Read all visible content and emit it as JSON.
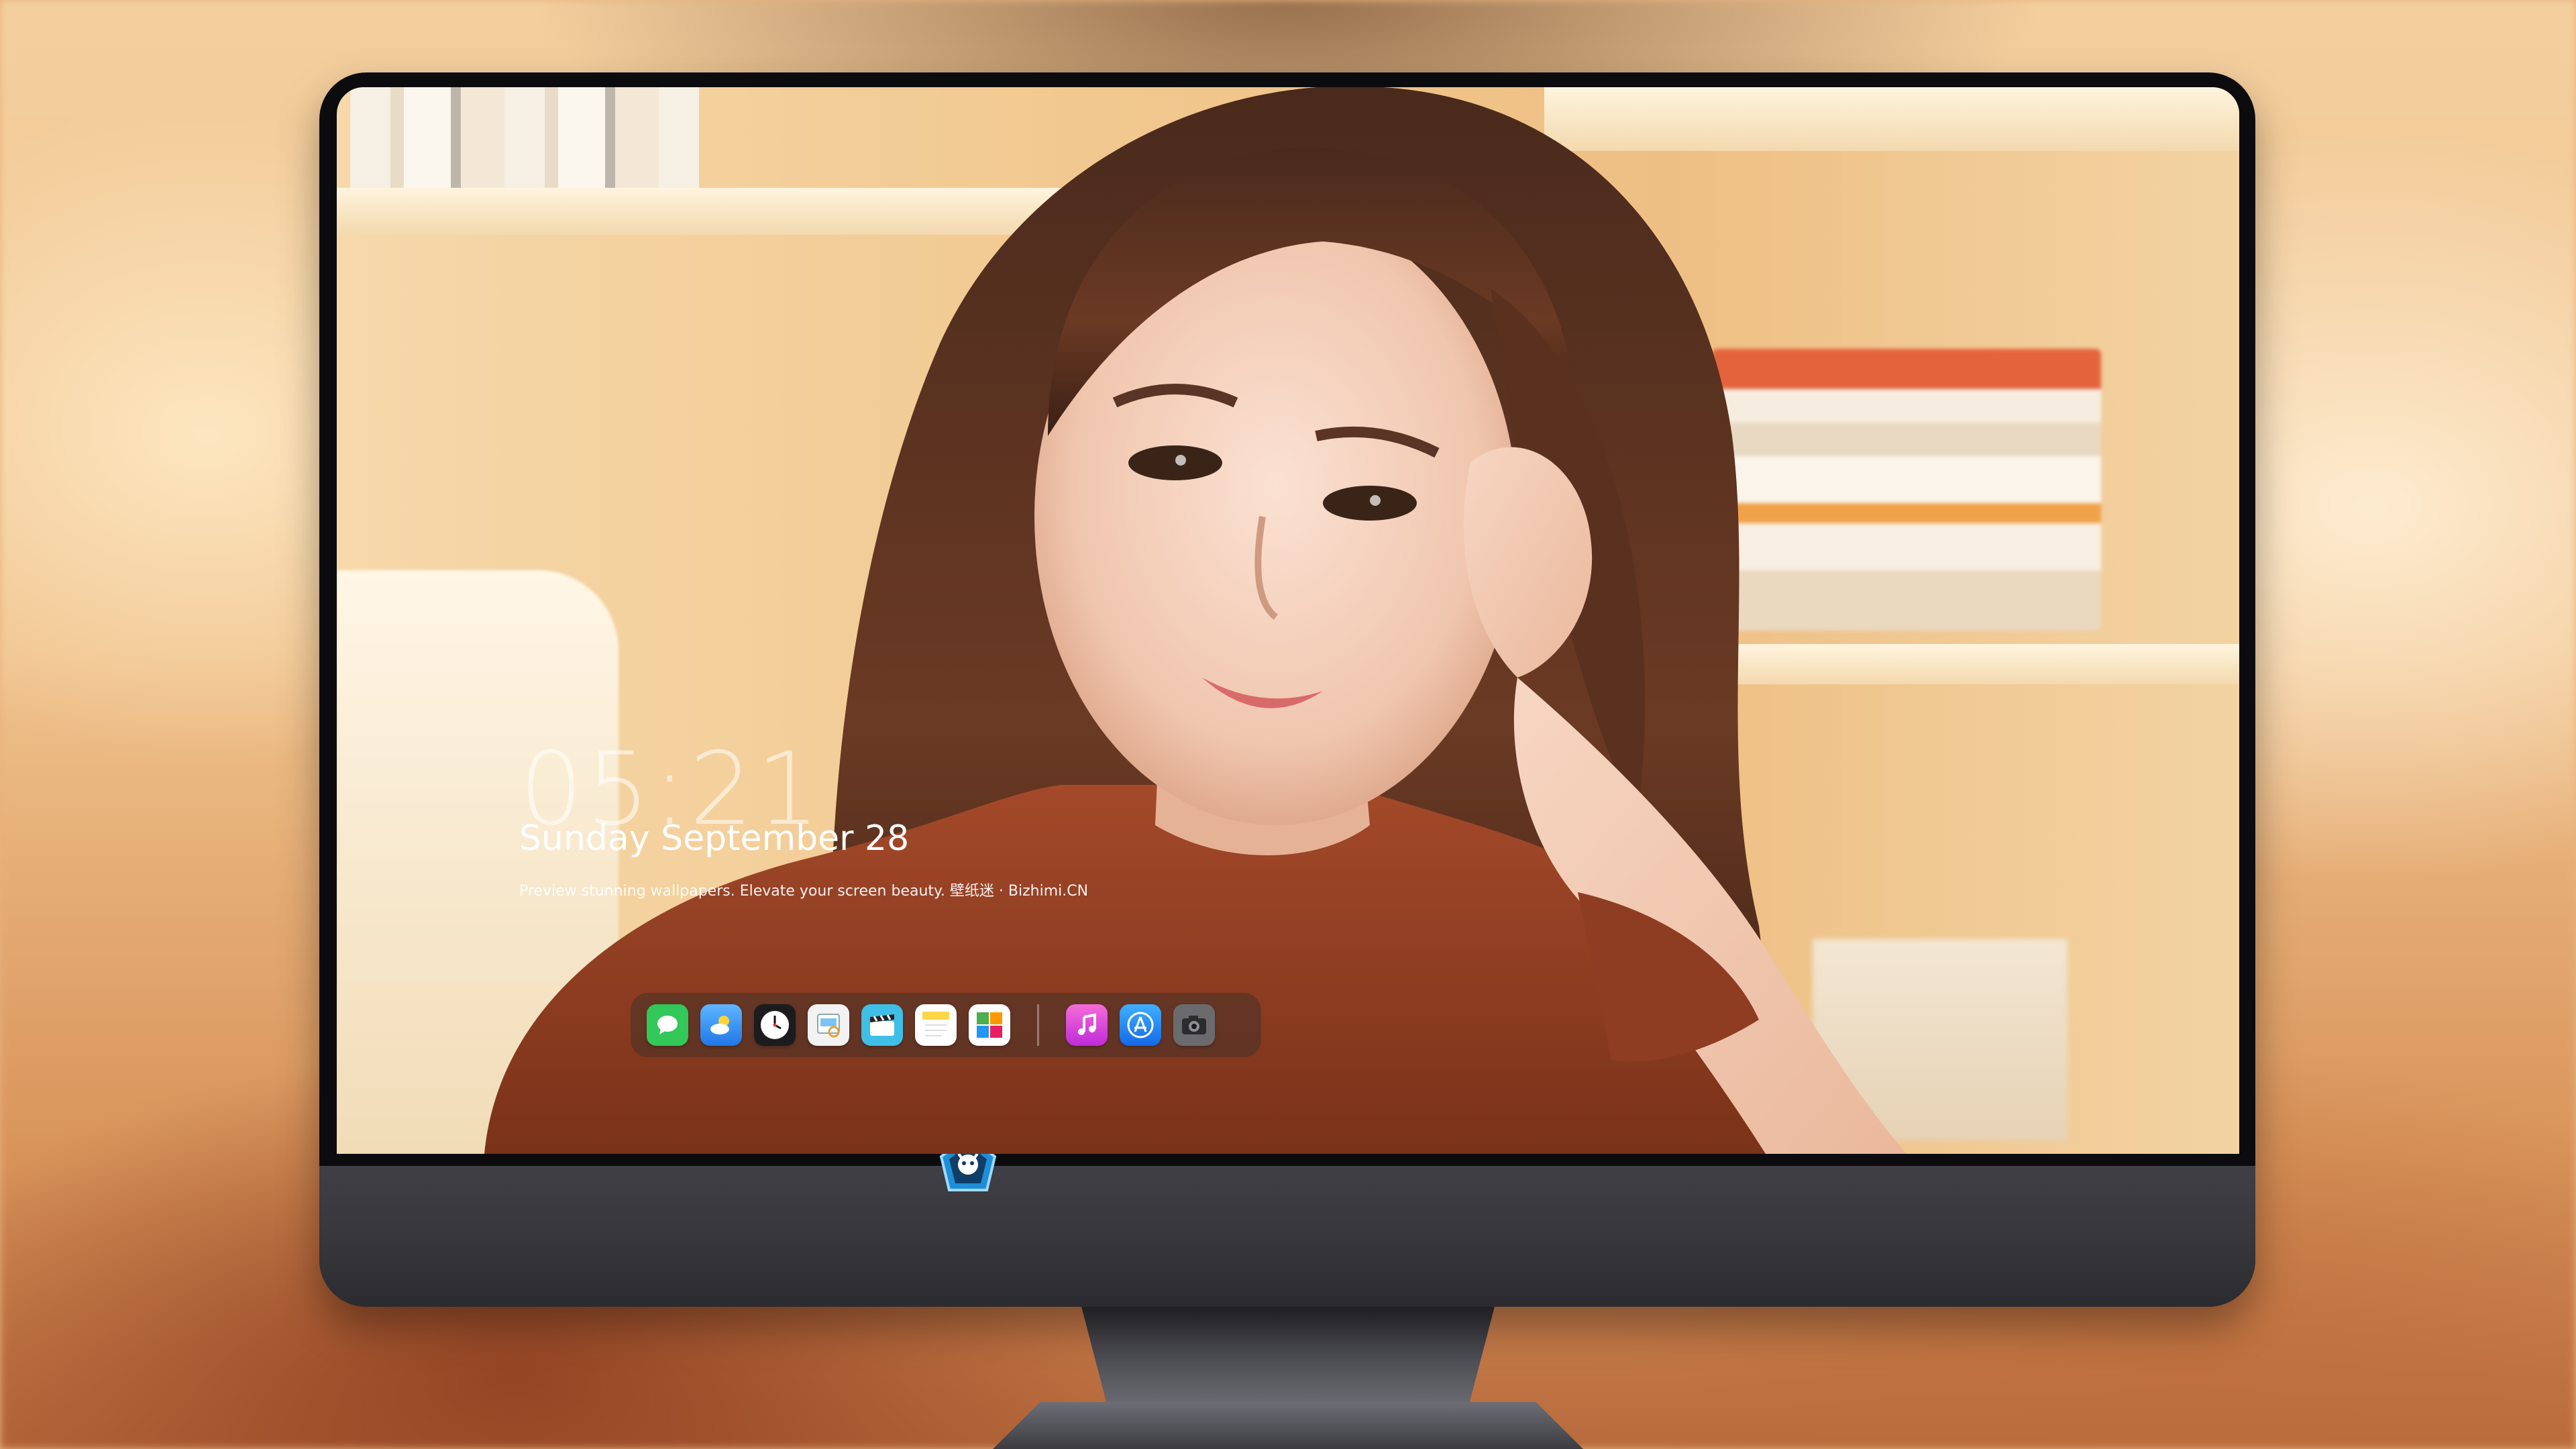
{
  "lockscreen": {
    "time": "05:21",
    "date": "Sunday September  28",
    "tagline": "Preview stunning wallpapers. Elevate your screen beauty. 壁纸迷 · Bizhimi.CN"
  },
  "dock": {
    "apps": [
      {
        "name": "messages-icon",
        "color": "#34c759"
      },
      {
        "name": "weather-icon",
        "color": "#2f8cf2"
      },
      {
        "name": "clock-icon",
        "color": "#1c1c1e"
      },
      {
        "name": "preview-icon",
        "color": "#f2f2f2"
      },
      {
        "name": "claquette-icon",
        "color": "#3fbfe6"
      },
      {
        "name": "notes-icon",
        "color": "#ffd64a"
      },
      {
        "name": "photo-slideshow-icon",
        "color": "#ffffff"
      },
      {
        "name": "music-icon",
        "color": "#e949c5"
      },
      {
        "name": "app-store-icon",
        "color": "#1d8cf0"
      },
      {
        "name": "camera-icon",
        "color": "#6b6b6e"
      }
    ]
  },
  "colors": {
    "monitor_frame": "#0c0c0e",
    "monitor_chin": "#3a3a40",
    "dock_bg": "rgba(70,50,40,0.55)"
  }
}
